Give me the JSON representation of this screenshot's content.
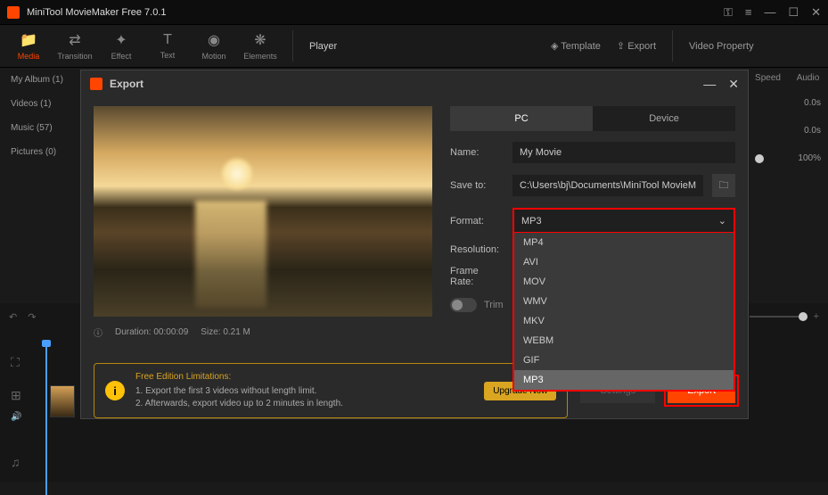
{
  "app": {
    "title": "MiniTool MovieMaker Free 7.0.1"
  },
  "toolbar": {
    "items": [
      {
        "label": "Media",
        "icon": "📁"
      },
      {
        "label": "Transition",
        "icon": "⇄"
      },
      {
        "label": "Effect",
        "icon": "✦"
      },
      {
        "label": "Text",
        "icon": "T"
      },
      {
        "label": "Motion",
        "icon": "◉"
      },
      {
        "label": "Elements",
        "icon": "❋"
      }
    ],
    "player": "Player",
    "template": "Template",
    "export": "Export",
    "video_property": "Video Property"
  },
  "sidebar": {
    "items": [
      {
        "label": "My Album (1)"
      },
      {
        "label": "Videos (1)"
      },
      {
        "label": "Music (57)"
      },
      {
        "label": "Pictures (0)"
      }
    ]
  },
  "prop": {
    "tab_speed": "Speed",
    "tab_audio": "Audio",
    "v1": "0.0s",
    "v2": "0.0s",
    "v3": "100%"
  },
  "dialog": {
    "title": "Export",
    "tabs": {
      "pc": "PC",
      "device": "Device"
    },
    "name_label": "Name:",
    "name_value": "My Movie",
    "saveto_label": "Save to:",
    "saveto_value": "C:\\Users\\bj\\Documents\\MiniTool MovieMaker\\outp",
    "format_label": "Format:",
    "format_value": "MP3",
    "format_options": [
      "MP4",
      "AVI",
      "MOV",
      "WMV",
      "MKV",
      "WEBM",
      "GIF",
      "MP3"
    ],
    "resolution_label": "Resolution:",
    "framerate_label": "Frame Rate:",
    "trim_label": "Trim",
    "duration_label": "Duration:",
    "duration_value": "00:00:09",
    "size_label": "Size:",
    "size_value": "0.21 M",
    "limitations": {
      "title": "Free Edition Limitations:",
      "line1": "1. Export the first 3 videos without length limit.",
      "line2": "2. Afterwards, export video up to 2 minutes in length."
    },
    "upgrade": "Upgrade Now",
    "settings": "Settings",
    "export": "Export"
  }
}
